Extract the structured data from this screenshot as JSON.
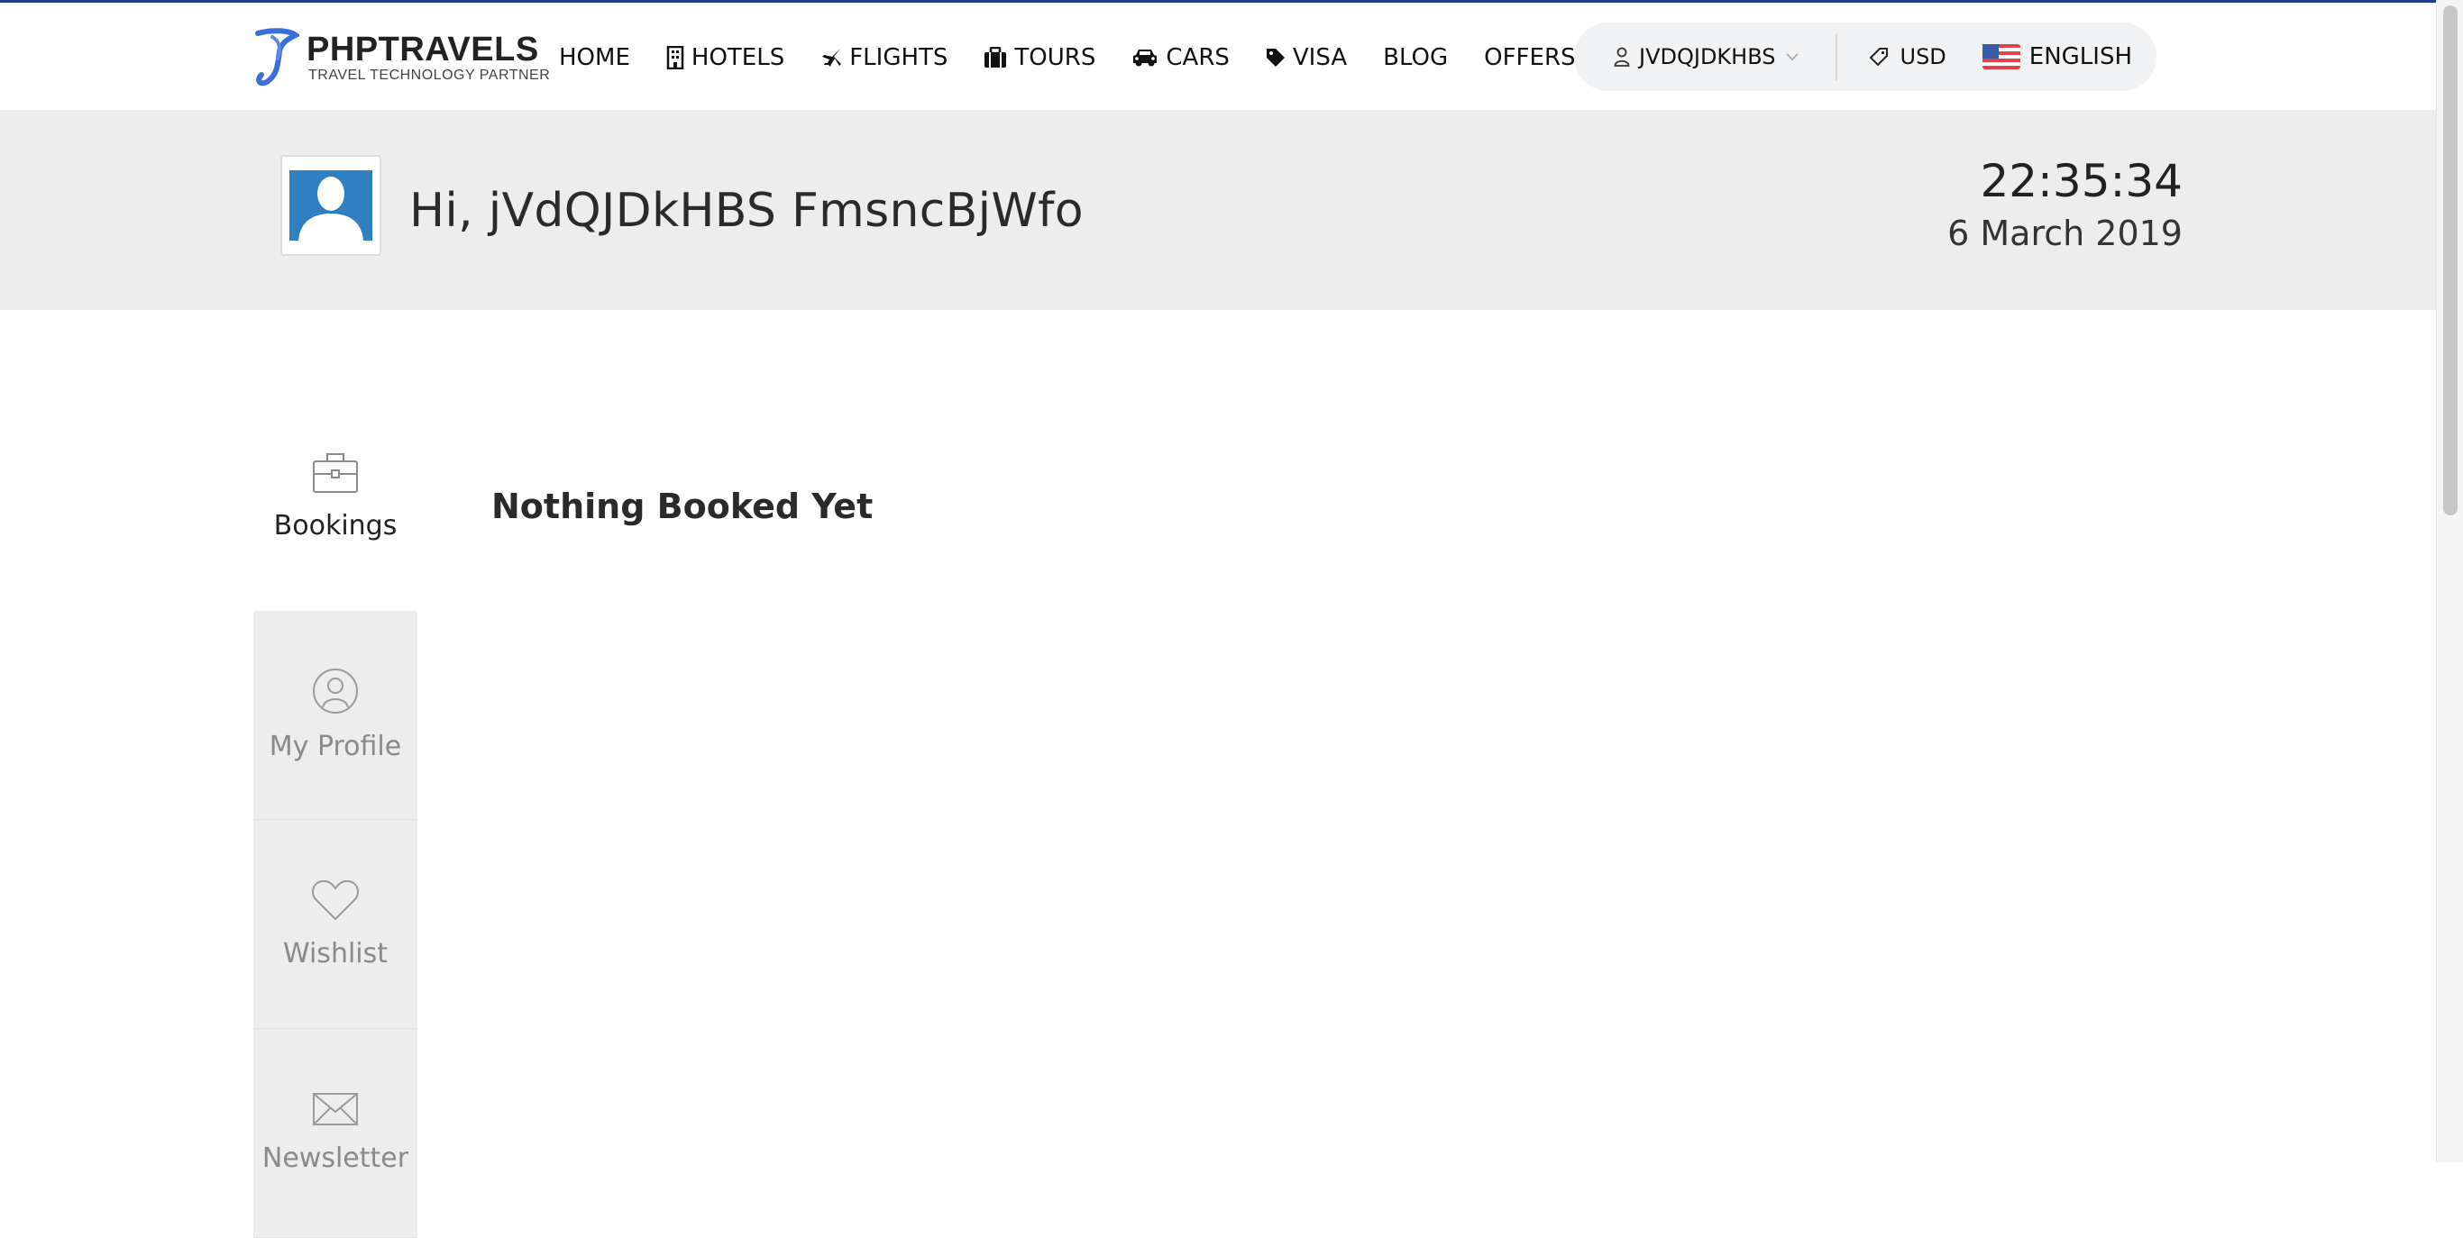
{
  "brand": {
    "name": "PHPTRAVELS",
    "tagline": "TRAVEL TECHNOLOGY PARTNER",
    "color": "#3b6fd8"
  },
  "nav": {
    "items": [
      {
        "label": "HOME",
        "icon": ""
      },
      {
        "label": "HOTELS",
        "icon": "building-icon"
      },
      {
        "label": "FLIGHTS",
        "icon": "plane-icon"
      },
      {
        "label": "TOURS",
        "icon": "suitcase-icon"
      },
      {
        "label": "CARS",
        "icon": "car-icon"
      },
      {
        "label": "VISA",
        "icon": "tag-icon"
      },
      {
        "label": "BLOG",
        "icon": ""
      },
      {
        "label": "OFFERS",
        "icon": ""
      }
    ]
  },
  "account": {
    "username": "JVDQJDKHBS",
    "currency": "USD",
    "language": "ENGLISH"
  },
  "greeting": {
    "text": "Hi, jVdQJDkHBS FmsncBjWfo",
    "time": "22:35:34",
    "date": "6 March 2019"
  },
  "sidebar": {
    "items": [
      {
        "label": "Bookings",
        "icon": "briefcase-icon",
        "active": true
      },
      {
        "label": "My Profile",
        "icon": "user-circle-icon",
        "active": false
      },
      {
        "label": "Wishlist",
        "icon": "heart-icon",
        "active": false
      },
      {
        "label": "Newsletter",
        "icon": "envelope-icon",
        "active": false
      }
    ]
  },
  "main": {
    "title": "Nothing Booked Yet"
  },
  "colors": {
    "topbar_border": "#1f3a8a",
    "band_bg": "#ededed",
    "avatar_blue": "#2f7fc1"
  }
}
